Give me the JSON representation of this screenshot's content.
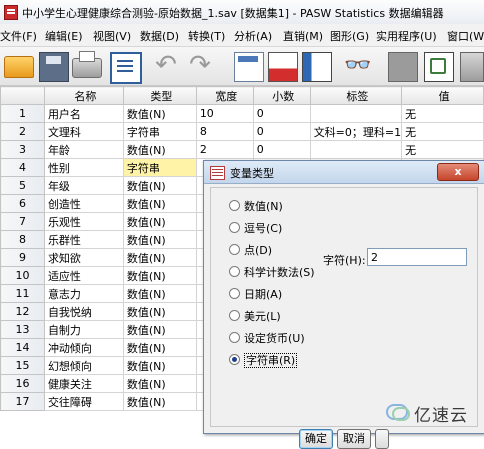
{
  "window": {
    "title": "中小学生心理健康综合测验-原始数据_1.sav [数据集1] - PASW Statistics 数据编辑器"
  },
  "menu": [
    "文件(F)",
    "编辑(E)",
    "视图(V)",
    "数据(D)",
    "转换(T)",
    "分析(A)",
    "直销(M)",
    "图形(G)",
    "实用程序(U)",
    "窗口(W)"
  ],
  "toolbar": {
    "icons": [
      "open-folder-icon",
      "save-icon",
      "print-icon",
      "dialog-recall-icon",
      "undo-icon",
      "redo-icon",
      "goto-case-icon",
      "insert-case-icon",
      "insert-variable-icon",
      "find-icon",
      "split-file-icon",
      "weight-cases-icon",
      "select-cases-icon"
    ],
    "undo_glyph": "↶",
    "redo_glyph": "↷",
    "find_glyph": "👓"
  },
  "grid": {
    "headers": [
      "",
      "名称",
      "类型",
      "宽度",
      "小数",
      "标签",
      "值"
    ],
    "rows": [
      [
        "1",
        "用户名",
        "数值(N)",
        "10",
        "0",
        "",
        "无"
      ],
      [
        "2",
        "文理科",
        "字符串",
        "8",
        "0",
        "文科=0；理科=1",
        "无"
      ],
      [
        "3",
        "年龄",
        "数值(N)",
        "2",
        "0",
        "",
        "无"
      ],
      [
        "4",
        "性别",
        "字符串",
        "",
        "",
        "",
        ""
      ],
      [
        "5",
        "年级",
        "数值(N)",
        "",
        "",
        "",
        ""
      ],
      [
        "6",
        "创造性",
        "数值(N)",
        "",
        "",
        "",
        ""
      ],
      [
        "7",
        "乐观性",
        "数值(N)",
        "",
        "",
        "",
        ""
      ],
      [
        "8",
        "乐群性",
        "数值(N)",
        "",
        "",
        "",
        ""
      ],
      [
        "9",
        "求知欲",
        "数值(N)",
        "",
        "",
        "",
        ""
      ],
      [
        "10",
        "适应性",
        "数值(N)",
        "",
        "",
        "",
        ""
      ],
      [
        "11",
        "意志力",
        "数值(N)",
        "",
        "",
        "",
        ""
      ],
      [
        "12",
        "自我悦纳",
        "数值(N)",
        "",
        "",
        "",
        ""
      ],
      [
        "13",
        "自制力",
        "数值(N)",
        "",
        "",
        "",
        ""
      ],
      [
        "14",
        "冲动倾向",
        "数值(N)",
        "",
        "",
        "",
        ""
      ],
      [
        "15",
        "幻想倾向",
        "数值(N)",
        "",
        "",
        "",
        ""
      ],
      [
        "16",
        "健康关注",
        "数值(N)",
        "",
        "",
        "",
        ""
      ],
      [
        "17",
        "交往障碍",
        "数值(N)",
        "",
        "",
        "",
        ""
      ]
    ]
  },
  "dialog": {
    "title": "变量类型",
    "close_label": "x",
    "options": [
      "数值(N)",
      "逗号(C)",
      "点(D)",
      "科学计数法(S)",
      "日期(A)",
      "美元(L)",
      "设定货币(U)",
      "字符串(R)"
    ],
    "selected": "字符串(R)",
    "characters_label": "字符(H):",
    "characters_value": "2",
    "ok_label": "确定",
    "cancel_label": "取消",
    "help_label": ""
  },
  "watermark": {
    "text": "亿速云"
  }
}
